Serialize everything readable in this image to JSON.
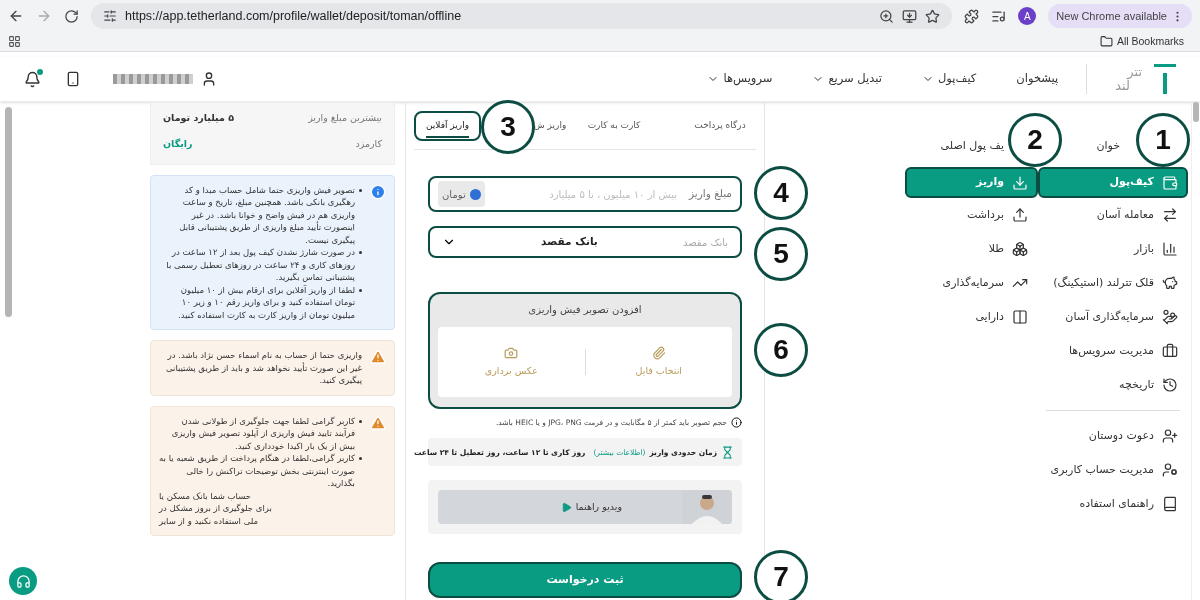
{
  "browser": {
    "url": "https://app.tetherland.com/profile/wallet/deposit/toman/offline",
    "profile": "A",
    "update_button": "New Chrome available",
    "bookmarks_folder": "All Bookmarks"
  },
  "header": {
    "logo": [
      "تتر",
      "لند"
    ],
    "nav": [
      {
        "label": "پیشخوان",
        "dropdown": false
      },
      {
        "label": "کیف‌پول",
        "dropdown": true
      },
      {
        "label": "تبدیل سریع",
        "dropdown": true
      },
      {
        "label": "سرویس‌ها",
        "dropdown": true
      }
    ],
    "unread_notifications": true
  },
  "sidebar": {
    "menu": [
      {
        "label": "خوان",
        "selected": false,
        "highlighted": false
      },
      {
        "label": "کیف‌پول",
        "selected": true,
        "highlighted": true
      },
      {
        "label": "معامله آسان",
        "selected": false,
        "highlighted": false
      },
      {
        "label": "بازار",
        "selected": false,
        "highlighted": false
      },
      {
        "label": "قلک تترلند (استیکینگ)",
        "selected": false,
        "highlighted": false
      },
      {
        "label": "سرمایه‌گذاری آسان",
        "selected": false,
        "highlighted": false
      },
      {
        "label": "مدیریت سرویس‌ها",
        "selected": false,
        "highlighted": false
      },
      {
        "label": "تاریخچه",
        "selected": false,
        "highlighted": false
      }
    ],
    "submenu": [
      {
        "label": "یف پول اصلی",
        "selected": false,
        "highlighted": false
      },
      {
        "label": "واریز",
        "selected": true,
        "highlighted": true
      },
      {
        "label": "برداشت",
        "selected": false,
        "highlighted": false
      },
      {
        "label": "طلا",
        "selected": false,
        "highlighted": false
      },
      {
        "label": "سرمایه‌گذاری",
        "selected": false,
        "highlighted": false
      },
      {
        "label": "دارایی",
        "selected": false,
        "highlighted": false
      }
    ],
    "bottom_menu": [
      {
        "label": "دعوت دوستان"
      },
      {
        "label": "مدیریت حساب کاربری"
      },
      {
        "label": "راهنمای استفاده"
      }
    ]
  },
  "form": {
    "tabs": [
      {
        "label": "درگاه پرداخت",
        "selected": false,
        "highlighted": false
      },
      {
        "label": "کارت به کارت",
        "selected": false,
        "highlighted": false
      },
      {
        "label": "واریز ش",
        "selected": false,
        "highlighted": false
      },
      {
        "label": "واریز آفلاین",
        "selected": true,
        "highlighted": true
      }
    ],
    "amount": {
      "label": "مبلغ واریز",
      "placeholder": "بیش از ۱۰ میلیون ، تا ۵ میلیارد",
      "unit": "تومان",
      "highlighted": true
    },
    "bank": {
      "label": "بانک مقصد",
      "value": "بانک مقصد",
      "highlighted": true
    },
    "upload": {
      "title": "افزودن تصویر فیش واریزی",
      "options": [
        "انتخاب فایل",
        "عکس برداری"
      ],
      "highlighted": true
    },
    "note": "حجم تصویر باید کمتر از ۵ مگابایت و در فرمت JPG، PNG و یا HEIC باشد.",
    "time": {
      "label": "زمان حدودی واریز",
      "link": "(اطلاعات بیشتر)",
      "value": "روز کاری تا ۱۲ ساعت، روز تعطیل تا ۲۴ ساعت"
    },
    "video": {
      "label": "ویدیو راهنما"
    },
    "submit": {
      "label": "ثبت درخواست",
      "highlighted": true
    }
  },
  "summary": [
    {
      "label": "بیشترین مبلغ واریز",
      "value": "۵ میلیارد تومان",
      "kind": "plain"
    },
    {
      "label": "کارمزد",
      "value": "رایگان",
      "kind": "free"
    }
  ],
  "alerts": [
    {
      "kind": "info",
      "items": [
        "تصویر فیش واریزی حتما شامل حساب مبدا و کد رهگیری بانکی باشد. همچنین مبلغ، تاریخ و ساعت واریزی هم در فیش واضح و خوانا باشد. در غیر اینصورت تأیید مبلغ واریزی از طریق پشتیبانی قابل پیگیری نیست.",
        "در صورت شارژ نشدن کیف پول بعد از ۱۲ ساعت در روزهای کاری و ۲۴ ساعت در روزهای تعطیل رسمی با پشتیبانی تماس بگیرید.",
        "لطفا از واریز آفلاین برای ارقام بیش از ۱۰ میلیون تومان استفاده کنید و برای واریز رقم ۱۰ و زیر ۱۰ میلیون تومان از واریز کارت به کارت استفاده کنید."
      ]
    },
    {
      "kind": "warning",
      "text": "واریزی حتما از حساب به نام اسماء حسن نژاد باشد. در غیر این صورت تأیید نخواهد شد و باید از طریق پشتیبانی پیگیری کنید."
    },
    {
      "kind": "warning",
      "items": [
        "کاربر گرامی لطفا جهت جلوگیری از طولانی شدن فرآیند تایید فیش واریزی از آپلود تصویر فیش واریزی بیش از یک بار اکیدا خودداری کنید.",
        "کاربر گرامی،لطفا در هنگام پرداخت از طریق شعبه یا به صورت اینترنتی بخش توضیحات تراکنش را خالی بگذارید."
      ],
      "fragments": [
        "حساب شما بانک مسکن یا",
        "برای جلوگیری از بروز مشکل در",
        "ملی استفاده نکنید و از سایر"
      ]
    }
  ],
  "annotations": [
    {
      "number": "1"
    },
    {
      "number": "2"
    },
    {
      "number": "3"
    },
    {
      "number": "4"
    },
    {
      "number": "5"
    },
    {
      "number": "6"
    },
    {
      "number": "7"
    }
  ]
}
